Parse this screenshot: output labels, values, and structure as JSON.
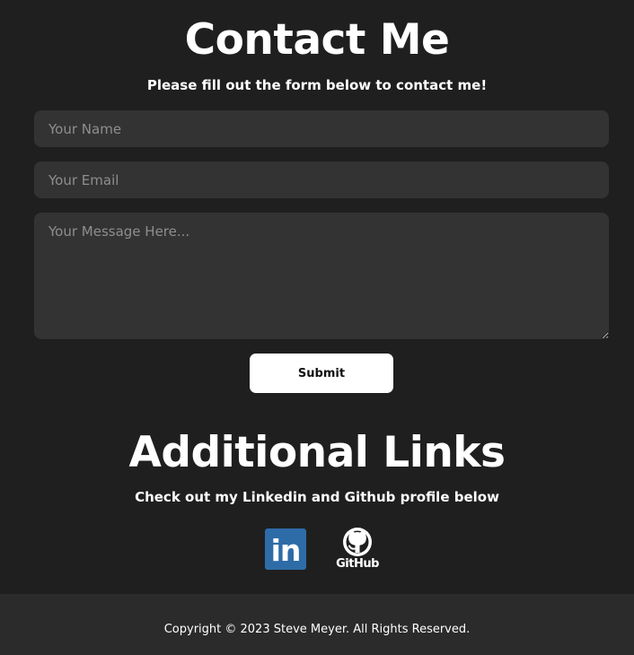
{
  "contact": {
    "title": "Contact Me",
    "subtitle": "Please fill out the form below to contact me!",
    "name_placeholder": "Your Name",
    "email_placeholder": "Your Email",
    "message_placeholder": "Your Message Here...",
    "submit_label": "Submit"
  },
  "links": {
    "title": "Additional Links",
    "subtitle": "Check out my Linkedin and Github profile below",
    "linkedin_icon": "linkedin-icon",
    "linkedin_text": "in",
    "linkedin_color": "#2e6ca8",
    "github_icon": "github-icon",
    "github_label": "GitHub"
  },
  "footer": {
    "copyright": "Copyright © 2023 Steve Meyer. All Rights Reserved."
  },
  "colors": {
    "background": "#1f1f1f",
    "field_background": "#333333",
    "footer_background": "#2b2b2b",
    "button_background": "#ffffff"
  }
}
